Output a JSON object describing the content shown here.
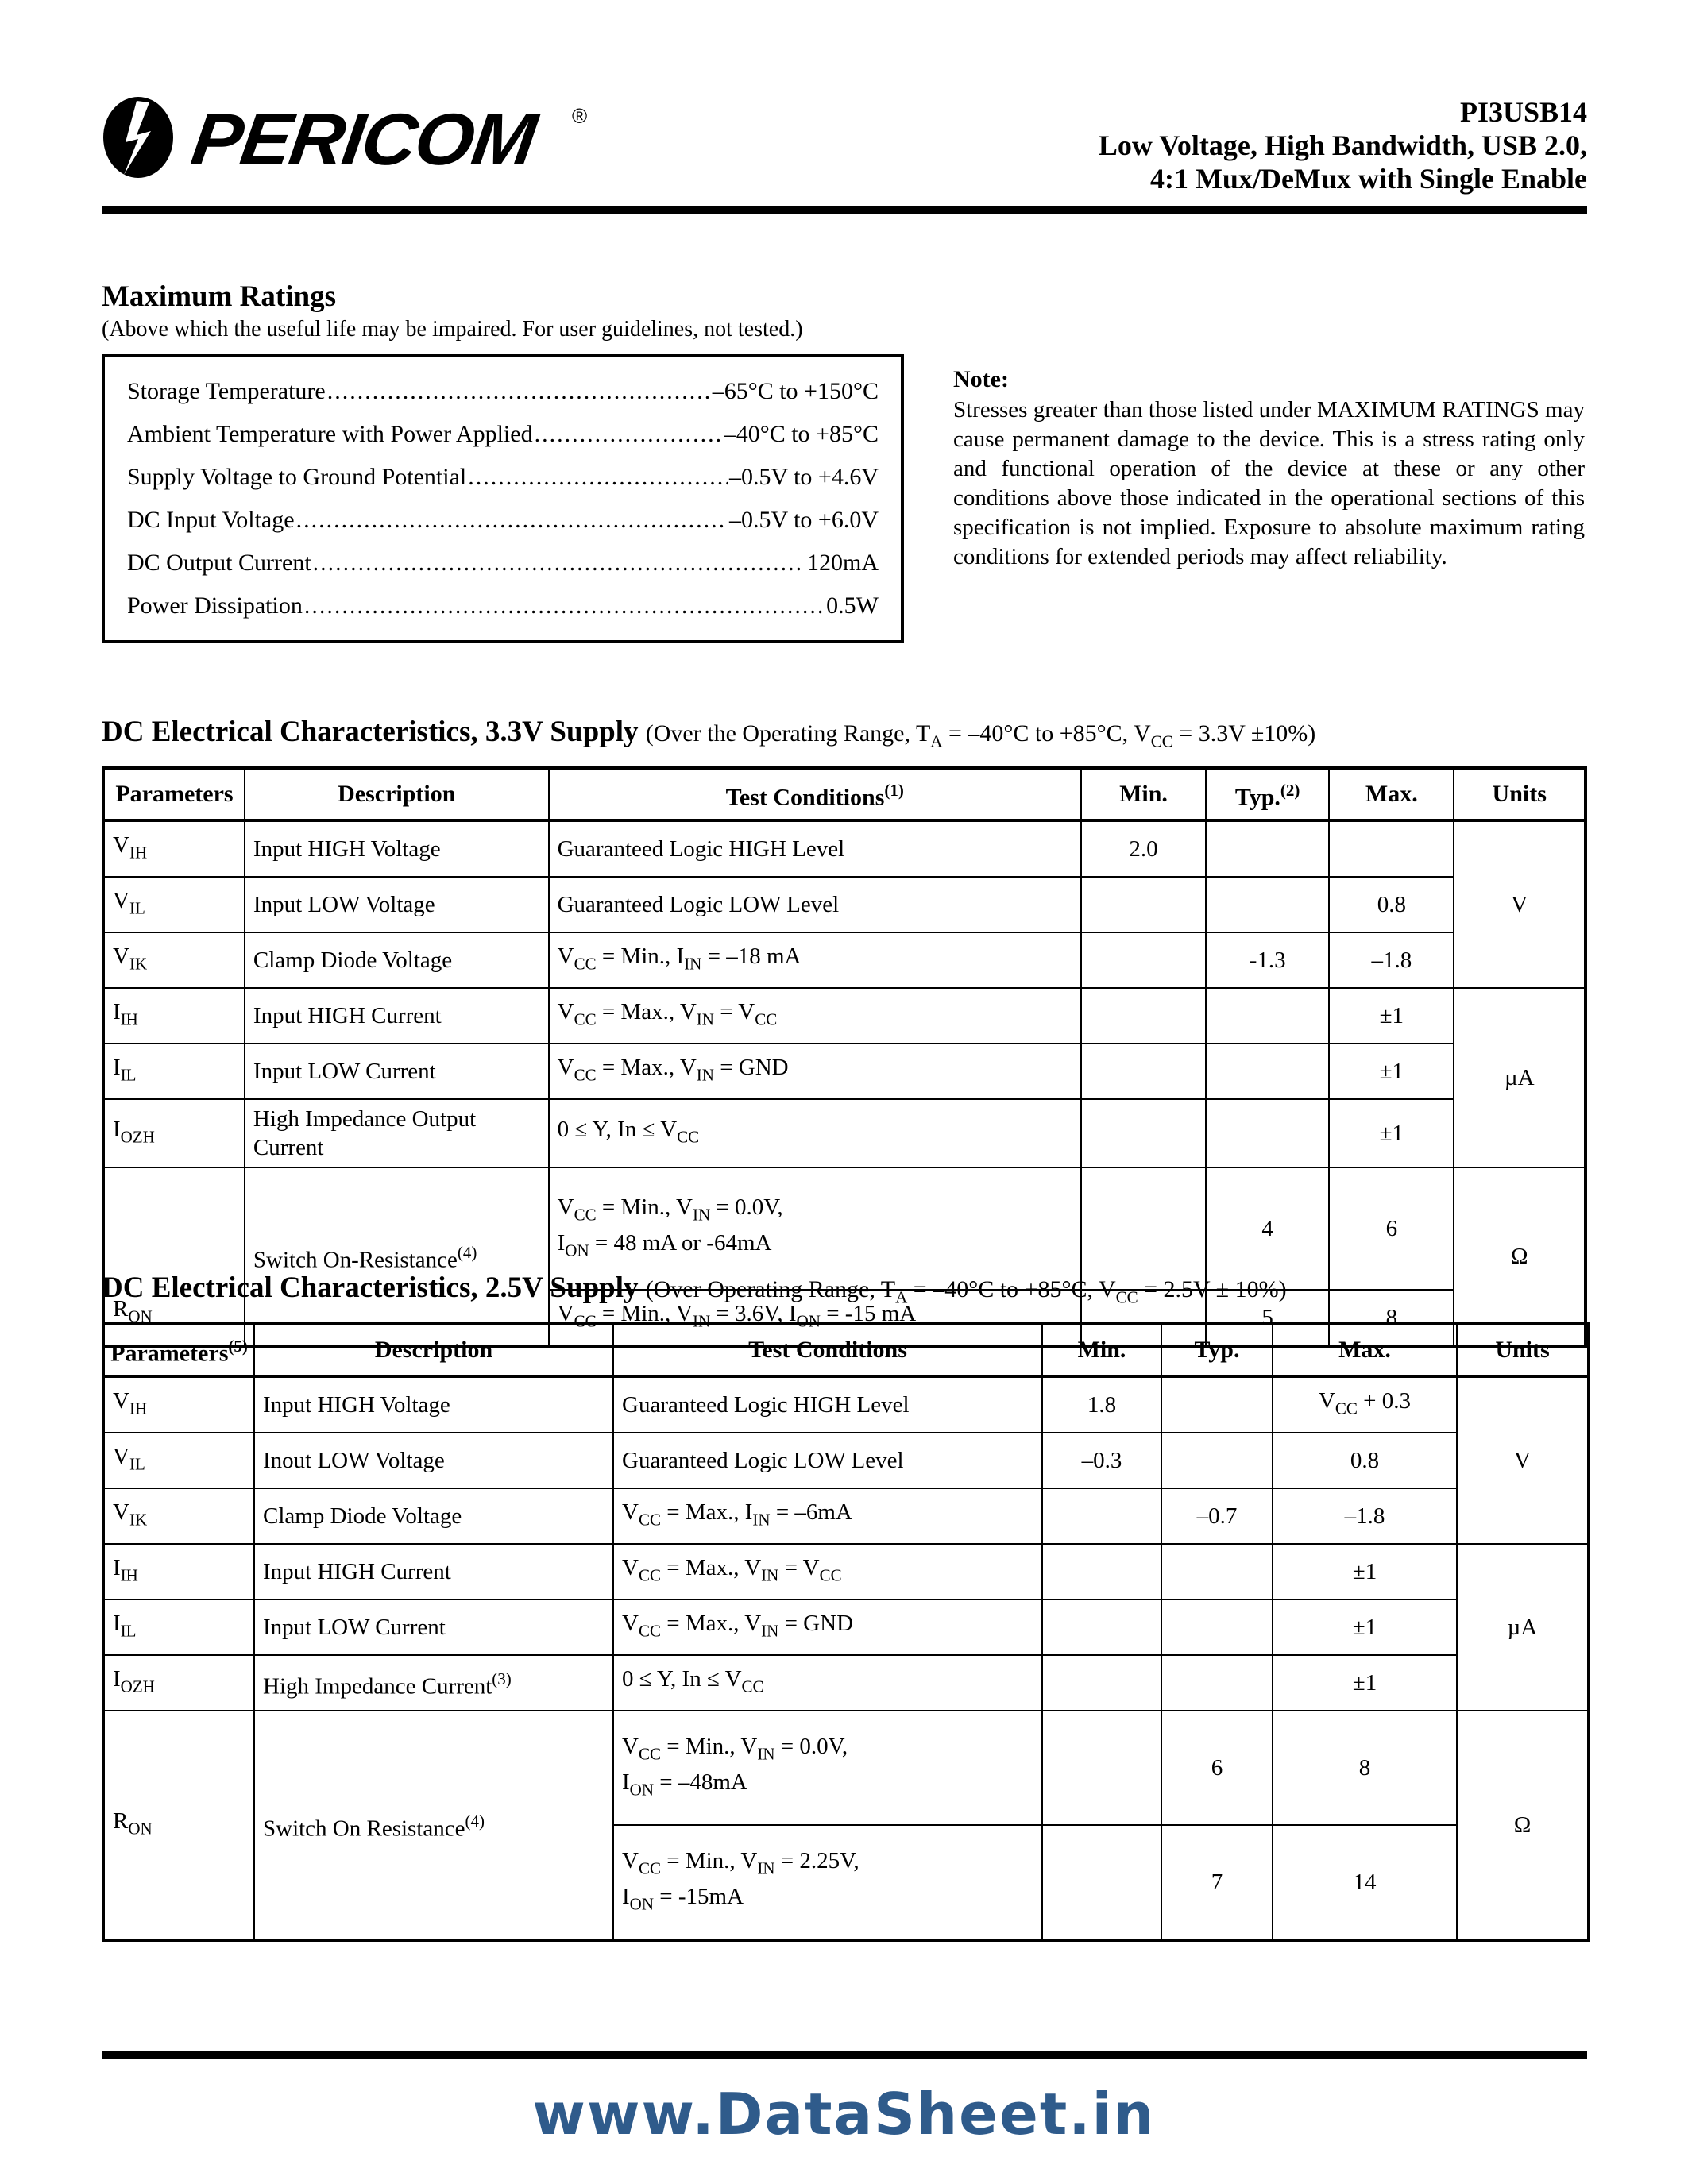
{
  "header": {
    "logo_text": "PERICOM",
    "logo_mark": "pericom-lightning-logo",
    "registered_mark": "®",
    "part_number": "PI3USB14",
    "title_line2": "Low Voltage, High Bandwidth, USB 2.0,",
    "title_line3": "4:1 Mux/DeMux with Single Enable"
  },
  "max_ratings": {
    "heading": "Maximum Ratings",
    "subheading": "(Above which the useful life may be impaired. For user guidelines, not tested.)",
    "rows": [
      {
        "name": "Storage Temperature",
        "value": "–65°C to +150°C"
      },
      {
        "name": "Ambient Temperature with Power Applied",
        "value": "–40°C to +85°C"
      },
      {
        "name": "Supply Voltage to Ground Potential",
        "value": "–0.5V to +4.6V"
      },
      {
        "name": "DC Input Voltage",
        "value": "–0.5V to +6.0V"
      },
      {
        "name": "DC Output Current",
        "value": "120mA"
      },
      {
        "name": "Power Dissipation",
        "value": "0.5W"
      }
    ]
  },
  "note": {
    "heading": "Note:",
    "body": "Stresses greater than those listed under MAXIMUM RATINGS may cause permanent damage to the device. This is a stress rating only and functional operation of the device at these or any other conditions above those indicated in the operational sections of this specification is not implied.  Exposure to absolute maximum rating conditions for extended periods may affect reliability."
  },
  "table_33v": {
    "title_bold": "DC Electrical Characteristics, 3.3V Supply",
    "title_conditions": "(Over the Operating Range, TA = –40°C to +85°C, VCC = 3.3V ±10%)",
    "columns": [
      "Parameters",
      "Description",
      "Test Conditions(1)",
      "Min.",
      "Typ.(2)",
      "Max.",
      "Units"
    ],
    "rows": [
      {
        "param": "VIH",
        "param_base": "V",
        "param_sub": "IH",
        "desc": "Input HIGH Voltage",
        "cond": "Guaranteed Logic HIGH Level",
        "min": "2.0",
        "typ": "",
        "max": "",
        "units": "V"
      },
      {
        "param": "VIL",
        "param_base": "V",
        "param_sub": "IL",
        "desc": "Input LOW Voltage",
        "cond": "Guaranteed Logic LOW Level",
        "min": "",
        "typ": "",
        "max": "0.8",
        "units": ""
      },
      {
        "param": "VIK",
        "param_base": "V",
        "param_sub": "IK",
        "desc": "Clamp Diode Voltage",
        "cond": "VCC = Min., IIN = –18 mA",
        "min": "",
        "typ": "-1.3",
        "max": "–1.8",
        "units": ""
      },
      {
        "param": "IIH",
        "param_base": "I",
        "param_sub": "IH",
        "desc": "Input HIGH Current",
        "cond": "VCC = Max., VIN = VCC",
        "min": "",
        "typ": "",
        "max": "±1",
        "units": ""
      },
      {
        "param": "IIL",
        "param_base": "I",
        "param_sub": "IL",
        "desc": "Input LOW Current",
        "cond": "VCC = Max., VIN = GND",
        "min": "",
        "typ": "",
        "max": "±1",
        "units": "µA"
      },
      {
        "param": "IOZH",
        "param_base": "I",
        "param_sub": "OZH",
        "desc": "High Impedance Output Current",
        "cond": "0 ≤ Y, In ≤ VCC",
        "min": "",
        "typ": "",
        "max": "±1",
        "units": ""
      },
      {
        "param": "RON",
        "param_base": "R",
        "param_sub": "ON",
        "desc": "Switch On-Resistance(4)",
        "cond_l1": "VCC = Min., VIN = 0.0V,",
        "cond_l2": "ION = 48 mA or -64mA",
        "min": "",
        "typ": "4",
        "max": "6",
        "units": "Ω"
      },
      {
        "param": "",
        "desc": "",
        "cond_l1": "VCC = Min., VIN = 3.6V, ION = -15 mA",
        "cond_l2": "",
        "min": "",
        "typ": "5",
        "max": "8",
        "units": ""
      }
    ]
  },
  "table_25v": {
    "title_bold": "DC Electrical Characteristics, 2.5V Supply",
    "title_conditions": "(Over  Operating Range, TA = –40°C to +85°C, VCC = 2.5V ± 10%)",
    "columns": [
      "Parameters(5)",
      "Description",
      "Test Conditions",
      "Min.",
      "Typ.",
      "Max.",
      "Units"
    ],
    "rows": [
      {
        "param": "VIH",
        "param_base": "V",
        "param_sub": "IH",
        "desc": "Input HIGH Voltage",
        "cond": "Guaranteed Logic HIGH Level",
        "min": "1.8",
        "typ": "",
        "max": "VCC + 0.3",
        "units": "V"
      },
      {
        "param": "VIL",
        "param_base": "V",
        "param_sub": "IL",
        "desc": "Inout LOW Voltage",
        "cond": "Guaranteed Logic LOW Level",
        "min": "–0.3",
        "typ": "",
        "max": "0.8",
        "units": ""
      },
      {
        "param": "VIK",
        "param_base": "V",
        "param_sub": "IK",
        "desc": "Clamp Diode Voltage",
        "cond": "VCC = Max., IIN = –6mA",
        "min": "",
        "typ": "–0.7",
        "max": "–1.8",
        "units": ""
      },
      {
        "param": "IIH",
        "param_base": "I",
        "param_sub": "IH",
        "desc": "Input HIGH Current",
        "cond": "VCC = Max., VIN = VCC",
        "min": "",
        "typ": "",
        "max": "±1",
        "units": ""
      },
      {
        "param": "IIL",
        "param_base": "I",
        "param_sub": "IL",
        "desc": "Input LOW Current",
        "cond": "VCC = Max., VIN = GND",
        "min": "",
        "typ": "",
        "max": "±1",
        "units": "µA"
      },
      {
        "param": "IOZH",
        "param_base": "I",
        "param_sub": "OZH",
        "desc": "High Impedance Current(3)",
        "cond": "0 ≤ Y, In ≤ VCC",
        "min": "",
        "typ": "",
        "max": "±1",
        "units": ""
      },
      {
        "param": "RON",
        "param_base": "R",
        "param_sub": "ON",
        "desc": "Switch On Resistance(4)",
        "cond_l1": "VCC = Min., VIN = 0.0V,",
        "cond_l2": "ION = –48mA",
        "min": "",
        "typ": "6",
        "max": "8",
        "units": "Ω"
      },
      {
        "param": "",
        "desc": "",
        "cond_l1": "VCC = Min., VIN = 2.25V,",
        "cond_l2": "ION = -15mA",
        "min": "",
        "typ": "7",
        "max": "14",
        "units": ""
      }
    ]
  },
  "footer": {
    "url": "www.DataSheet.in",
    "url_color": "#2f5b8b"
  }
}
